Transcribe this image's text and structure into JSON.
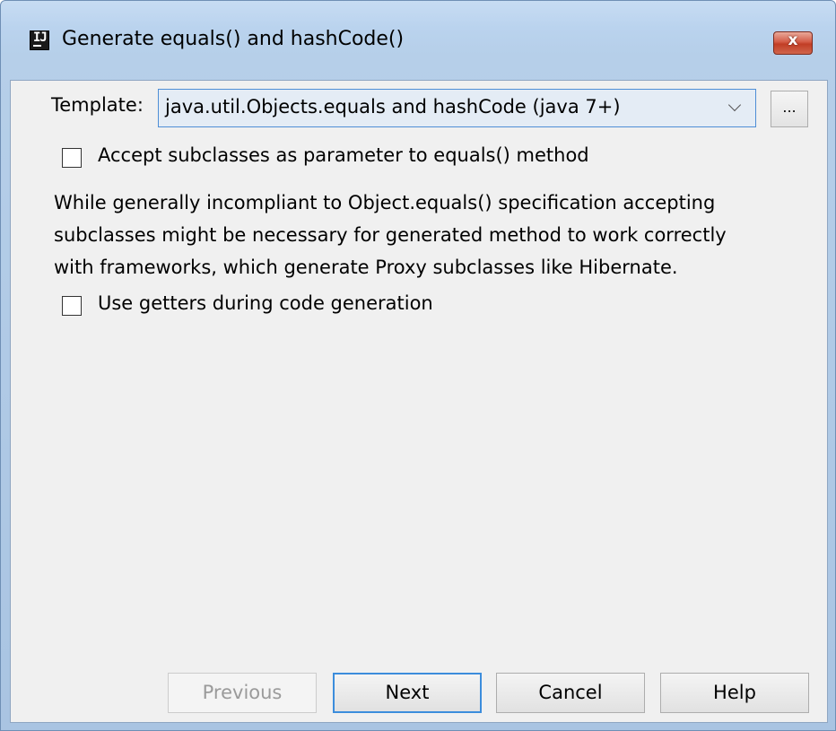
{
  "window": {
    "title": "Generate equals() and hashCode()",
    "close_glyph": "x",
    "app_icon": "intellij-idea-icon"
  },
  "form": {
    "template_label": "Template:",
    "template_value": "java.util.Objects.equals and hashCode (java 7+)",
    "browse_label": "...",
    "accept_subclasses_label": "Accept subclasses as parameter to equals() method",
    "accept_subclasses_checked": false,
    "description_lines": [
      "While generally incompliant to Object.equals() specification accepting",
      "subclasses might be necessary for generated method to work correctly",
      "with frameworks, which generate Proxy subclasses like Hibernate."
    ],
    "use_getters_label": "Use getters during code generation",
    "use_getters_checked": false
  },
  "buttons": {
    "previous": "Previous",
    "next": "Next",
    "cancel": "Cancel",
    "help": "Help"
  },
  "colors": {
    "focus_border": "#4e8ed6",
    "default_button_border": "#3c8ddc",
    "close_button": "#c13e26",
    "dialog_background": "#f0f0f0"
  }
}
